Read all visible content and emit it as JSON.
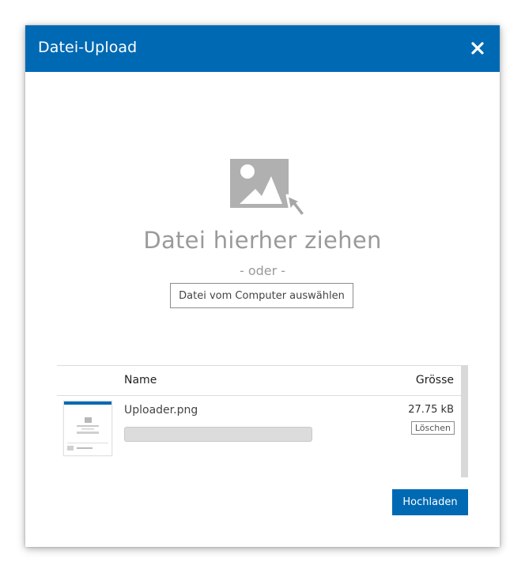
{
  "dialog": {
    "title": "Datei-Upload",
    "close_icon": "close-icon",
    "accent": "#0069b4"
  },
  "dropzone": {
    "icon": "image-drop-icon",
    "title": "Datei hierher ziehen",
    "or_text": "- oder -",
    "choose_button": "Datei vom Computer auswählen"
  },
  "file_table": {
    "columns": {
      "name": "Name",
      "size": "Grösse"
    },
    "files": [
      {
        "name": "Uploader.png",
        "size": "27.75 kB",
        "delete_label": "Löschen",
        "progress": 0
      }
    ]
  },
  "footer": {
    "upload_button": "Hochladen"
  }
}
